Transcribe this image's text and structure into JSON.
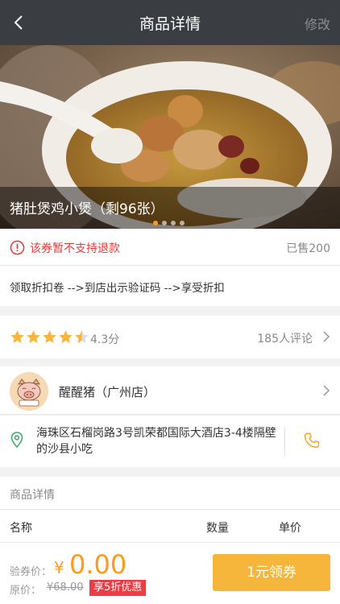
{
  "nav": {
    "title": "商品详情",
    "edit_label": "修改"
  },
  "hero": {
    "caption": "猪肚煲鸡小煲（剩96张）",
    "dots": 4,
    "active_dot": 0
  },
  "refund": {
    "warning": "该券暂不支持退款",
    "sold": "已售200"
  },
  "steps": {
    "text": "领取折扣卷 -->到店出示验证码 -->享受折扣"
  },
  "rating": {
    "stars": 4.3,
    "score": "4.3分",
    "reviews": "185人评论"
  },
  "shop": {
    "name": "醒醒猪（广州店）"
  },
  "address": {
    "text": "海珠区石榴岗路3号凯荣都国际大酒店3-4楼隔壁的沙县小吃"
  },
  "section": {
    "title": "商品详情"
  },
  "table": {
    "headers": [
      "名称",
      "数量",
      "单价"
    ]
  },
  "bottom": {
    "price_label": "验券价：",
    "currency": "¥",
    "price": "0.00",
    "original_label": "原价：",
    "original_price": "¥68.00",
    "badge": "享5折优惠",
    "button_label": "1元领券"
  },
  "colors": {
    "accent": "#ff9a1f",
    "button": "#f6b63c",
    "warning": "#e23b3b",
    "nav": "#3a3d42",
    "badge": "#ea3d45"
  }
}
